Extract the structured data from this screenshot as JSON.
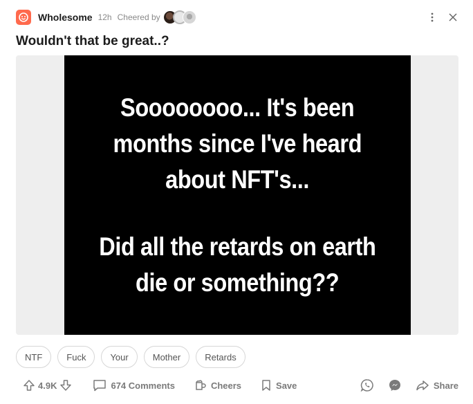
{
  "header": {
    "community": "Wholesome",
    "time": "12h",
    "cheered_by_label": "Cheered by"
  },
  "post": {
    "title": "Wouldn't that be great..?",
    "meme": {
      "lines_top": [
        "Soooooooo... It's been",
        "months since I've heard",
        "about NFT's..."
      ],
      "lines_bottom": [
        "Did all the retards on earth",
        "die or something??"
      ]
    },
    "tags": [
      "NTF",
      "Fuck",
      "Your",
      "Mother",
      "Retards"
    ]
  },
  "actions": {
    "votes": "4.9K",
    "comments": "674 Comments",
    "cheers": "Cheers",
    "save": "Save",
    "share": "Share"
  },
  "colors": {
    "community_icon": "#ff6a4d",
    "messenger": "#7a7a7a",
    "whatsapp": "#7a7a7a"
  },
  "icons": {
    "community": "smiley-icon",
    "more": "kebab-icon",
    "close": "close-icon",
    "upvote": "arrow-up-icon",
    "downvote": "arrow-down-icon",
    "comments": "comment-icon",
    "cheers": "cheers-icon",
    "save": "bookmark-icon",
    "whatsapp": "whatsapp-icon",
    "messenger": "messenger-icon",
    "share": "share-icon"
  }
}
